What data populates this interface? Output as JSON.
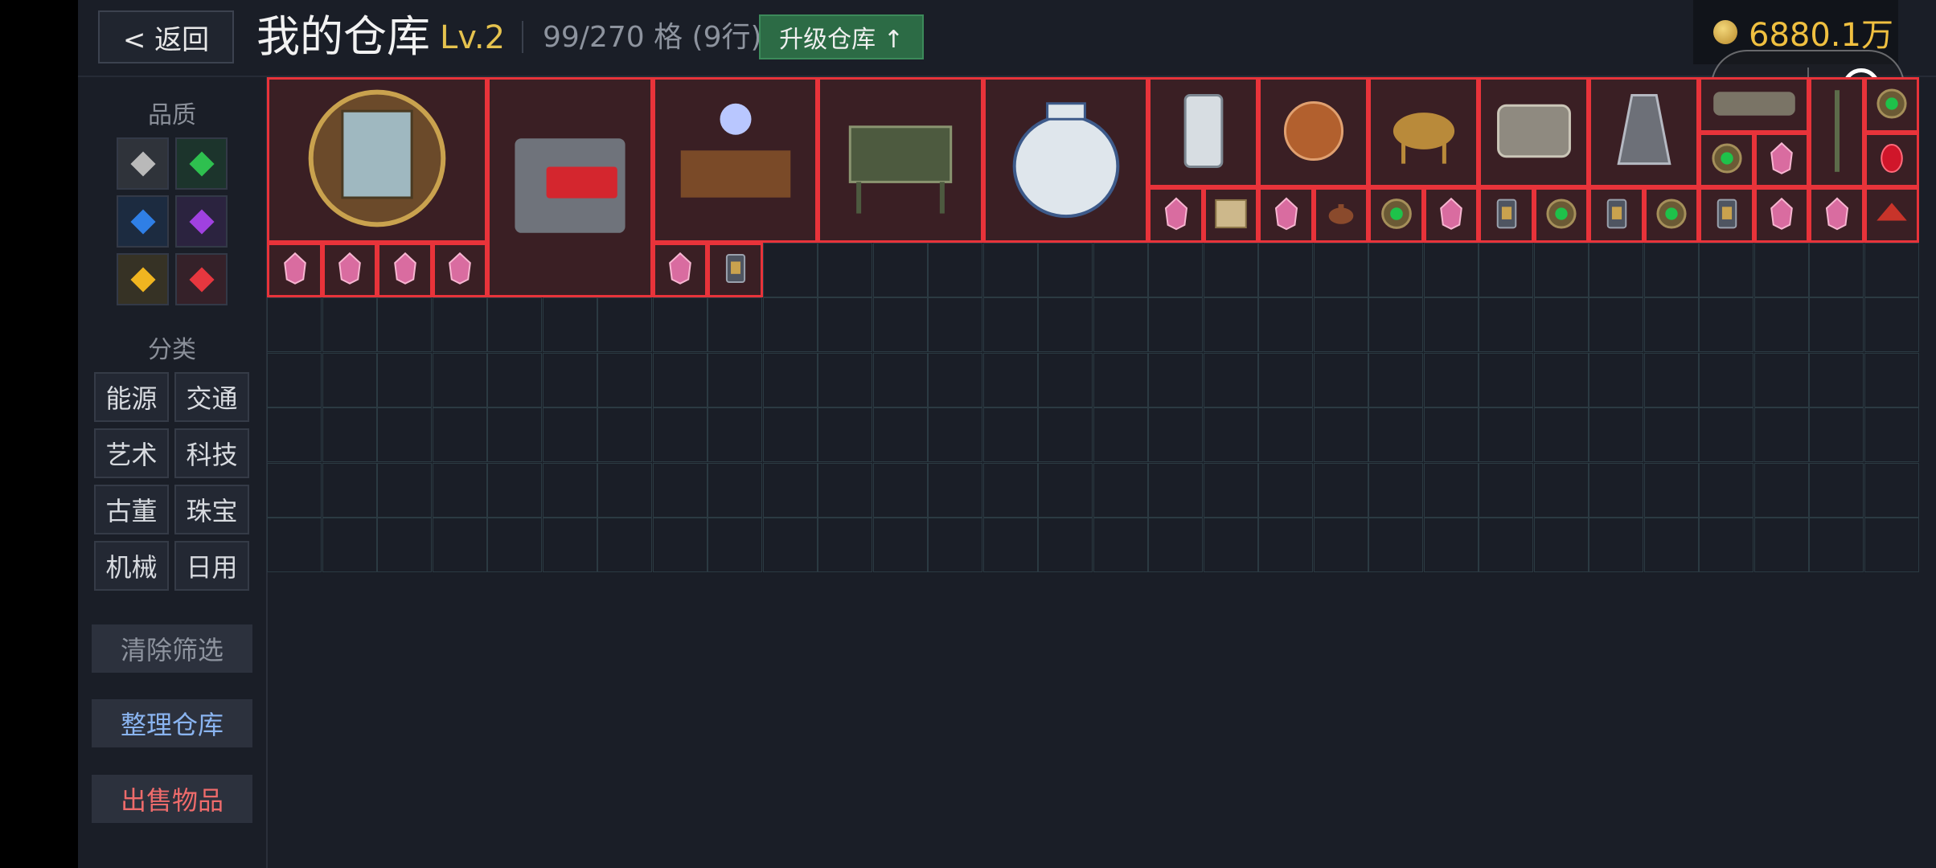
{
  "header": {
    "back_label": "< 返回",
    "title": "我的仓库",
    "level": "Lv.2",
    "capacity": "99/270 格 (9行)",
    "upgrade_label": "升级仓库 ↑",
    "coins": "6880.1万",
    "capsule_more": "•••"
  },
  "sidebar": {
    "quality_label": "品质",
    "quality_colors": [
      "#b9b9b9",
      "#2ec04f",
      "#2f7fe6",
      "#a041e0",
      "#f0b520",
      "#e6373f"
    ],
    "category_label": "分类",
    "categories": [
      "能源",
      "交通",
      "艺术",
      "科技",
      "古董",
      "珠宝",
      "机械",
      "日用"
    ],
    "clear_filter": "清除筛选",
    "sort_warehouse": "整理仓库",
    "sell_items": "出售物品"
  },
  "colors": {
    "accent_gold": "#e5c24e",
    "upgrade_green": "#2c6b45",
    "item_border": "#e8333a",
    "sell_text": "#ee6b6b",
    "sort_text": "#8ab4f0"
  },
  "warehouse": {
    "cols": 30,
    "rows": 9,
    "used": 99,
    "total": 270,
    "items": [
      {
        "icon": "landscape-painting-icon",
        "c": 0,
        "r": 0,
        "w": 4,
        "h": 3
      },
      {
        "icon": "engine-icon",
        "c": 4,
        "r": 0,
        "w": 3,
        "h": 4
      },
      {
        "icon": "tesla-machine-icon",
        "c": 7,
        "r": 0,
        "w": 3,
        "h": 3
      },
      {
        "icon": "bronze-ding-icon",
        "c": 10,
        "r": 0,
        "w": 3,
        "h": 3
      },
      {
        "icon": "porcelain-vase-icon",
        "c": 13,
        "r": 0,
        "w": 3,
        "h": 3
      },
      {
        "icon": "reactor-icon",
        "c": 16,
        "r": 0,
        "w": 2,
        "h": 2
      },
      {
        "icon": "generator-coil-icon",
        "c": 18,
        "r": 0,
        "w": 2,
        "h": 2
      },
      {
        "icon": "camel-statue-icon",
        "c": 20,
        "r": 0,
        "w": 2,
        "h": 2
      },
      {
        "icon": "gear-drum-icon",
        "c": 22,
        "r": 0,
        "w": 2,
        "h": 2
      },
      {
        "icon": "rocket-engine-icon",
        "c": 24,
        "r": 0,
        "w": 2,
        "h": 2
      },
      {
        "icon": "mechanism-icon",
        "c": 26,
        "r": 0,
        "w": 2,
        "h": 1
      },
      {
        "icon": "sword-icon",
        "c": 28,
        "r": 0,
        "w": 1,
        "h": 2
      },
      {
        "icon": "emerald-ring-icon",
        "c": 29,
        "r": 0,
        "w": 1,
        "h": 1
      },
      {
        "icon": "emerald-ring-icon",
        "c": 26,
        "r": 1,
        "w": 1,
        "h": 1
      },
      {
        "icon": "pink-gem-icon",
        "c": 27,
        "r": 1,
        "w": 1,
        "h": 1
      },
      {
        "icon": "ruby-icon",
        "c": 29,
        "r": 1,
        "w": 1,
        "h": 1
      },
      {
        "icon": "pink-gem-icon",
        "c": 16,
        "r": 2,
        "w": 1,
        "h": 1
      },
      {
        "icon": "parchment-icon",
        "c": 17,
        "r": 2,
        "w": 1,
        "h": 1
      },
      {
        "icon": "pink-gem-icon",
        "c": 18,
        "r": 2,
        "w": 1,
        "h": 1
      },
      {
        "icon": "teapot-icon",
        "c": 19,
        "r": 2,
        "w": 1,
        "h": 1
      },
      {
        "icon": "emerald-ring-icon",
        "c": 20,
        "r": 2,
        "w": 1,
        "h": 1
      },
      {
        "icon": "pink-gem-icon",
        "c": 21,
        "r": 2,
        "w": 1,
        "h": 1
      },
      {
        "icon": "battery-icon",
        "c": 22,
        "r": 2,
        "w": 1,
        "h": 1
      },
      {
        "icon": "emerald-ring-icon",
        "c": 23,
        "r": 2,
        "w": 1,
        "h": 1
      },
      {
        "icon": "battery-icon",
        "c": 24,
        "r": 2,
        "w": 1,
        "h": 1
      },
      {
        "icon": "emerald-ring-icon",
        "c": 25,
        "r": 2,
        "w": 1,
        "h": 1
      },
      {
        "icon": "battery-icon",
        "c": 26,
        "r": 2,
        "w": 1,
        "h": 1
      },
      {
        "icon": "pink-gem-icon",
        "c": 27,
        "r": 2,
        "w": 1,
        "h": 1
      },
      {
        "icon": "pink-gem-icon",
        "c": 28,
        "r": 2,
        "w": 1,
        "h": 1
      },
      {
        "icon": "red-hat-icon",
        "c": 29,
        "r": 2,
        "w": 1,
        "h": 1
      },
      {
        "icon": "pink-gem-icon",
        "c": 0,
        "r": 3,
        "w": 1,
        "h": 1
      },
      {
        "icon": "pink-gem-icon",
        "c": 1,
        "r": 3,
        "w": 1,
        "h": 1
      },
      {
        "icon": "pink-gem-icon",
        "c": 2,
        "r": 3,
        "w": 1,
        "h": 1
      },
      {
        "icon": "pink-gem-icon",
        "c": 3,
        "r": 3,
        "w": 1,
        "h": 1
      },
      {
        "icon": "pink-gem-icon",
        "c": 7,
        "r": 3,
        "w": 1,
        "h": 1
      },
      {
        "icon": "battery-icon",
        "c": 8,
        "r": 3,
        "w": 1,
        "h": 1
      }
    ]
  }
}
